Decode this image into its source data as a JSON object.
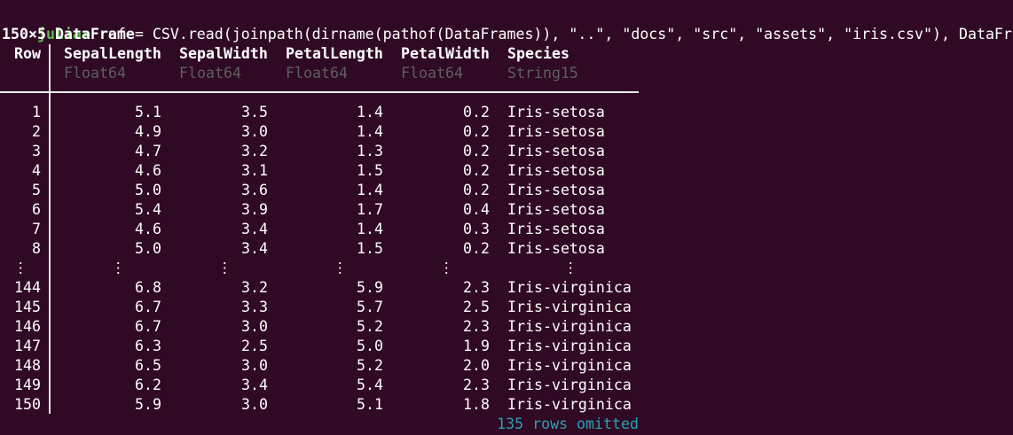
{
  "terminal": {
    "prompt": "julia>",
    "command": " ref = CSV.read(joinpath(dirname(pathof(DataFrames)), \"..\", \"docs\", \"src\", \"assets\", \"iris.csv\"), DataFrame)",
    "summary": "150×5 DataFrame",
    "row_header": "Row",
    "columns": [
      {
        "name": "SepalLength",
        "type": "Float64"
      },
      {
        "name": "SepalWidth",
        "type": "Float64"
      },
      {
        "name": "PetalLength",
        "type": "Float64"
      },
      {
        "name": "PetalWidth",
        "type": "Float64"
      },
      {
        "name": "Species",
        "type": "String15"
      }
    ],
    "rows_top": [
      [
        "1",
        "5.1",
        "3.5",
        "1.4",
        "0.2",
        "Iris-setosa"
      ],
      [
        "2",
        "4.9",
        "3.0",
        "1.4",
        "0.2",
        "Iris-setosa"
      ],
      [
        "3",
        "4.7",
        "3.2",
        "1.3",
        "0.2",
        "Iris-setosa"
      ],
      [
        "4",
        "4.6",
        "3.1",
        "1.5",
        "0.2",
        "Iris-setosa"
      ],
      [
        "5",
        "5.0",
        "3.6",
        "1.4",
        "0.2",
        "Iris-setosa"
      ],
      [
        "6",
        "5.4",
        "3.9",
        "1.7",
        "0.4",
        "Iris-setosa"
      ],
      [
        "7",
        "4.6",
        "3.4",
        "1.4",
        "0.3",
        "Iris-setosa"
      ],
      [
        "8",
        "5.0",
        "3.4",
        "1.5",
        "0.2",
        "Iris-setosa"
      ]
    ],
    "ellipsis": "⋮",
    "rows_bottom": [
      [
        "144",
        "6.8",
        "3.2",
        "5.9",
        "2.3",
        "Iris-virginica"
      ],
      [
        "145",
        "6.7",
        "3.3",
        "5.7",
        "2.5",
        "Iris-virginica"
      ],
      [
        "146",
        "6.7",
        "3.0",
        "5.2",
        "2.3",
        "Iris-virginica"
      ],
      [
        "147",
        "6.3",
        "2.5",
        "5.0",
        "1.9",
        "Iris-virginica"
      ],
      [
        "148",
        "6.5",
        "3.0",
        "5.2",
        "2.0",
        "Iris-virginica"
      ],
      [
        "149",
        "6.2",
        "3.4",
        "5.4",
        "2.3",
        "Iris-virginica"
      ],
      [
        "150",
        "5.9",
        "3.0",
        "5.1",
        "1.8",
        "Iris-virginica"
      ]
    ],
    "omitted": "135 rows omitted"
  }
}
